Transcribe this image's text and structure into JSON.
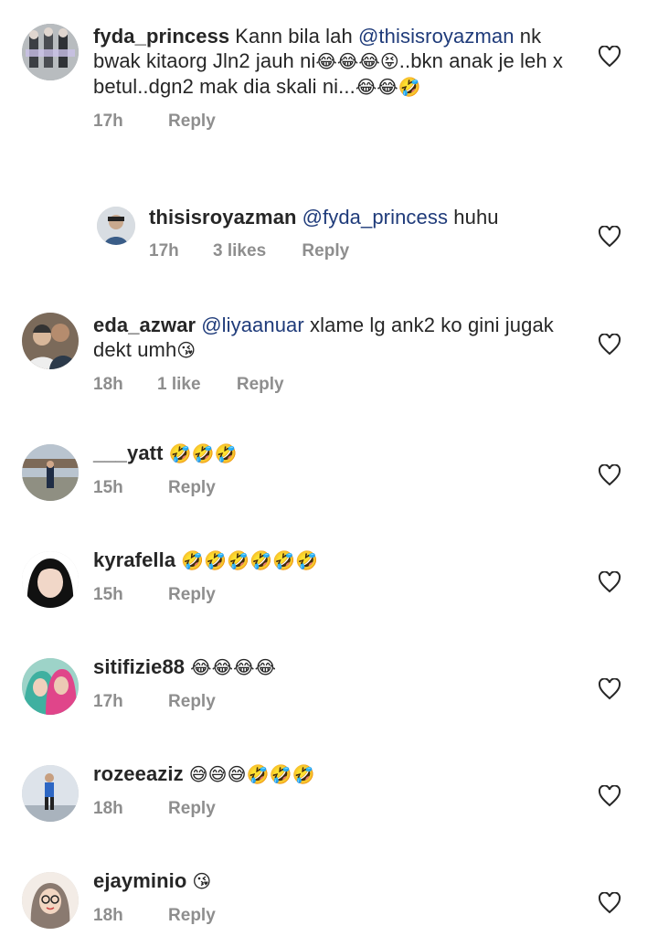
{
  "reply_label": "Reply",
  "comments": [
    {
      "username": "fyda_princess",
      "segments": [
        {
          "t": "Kann bila lah "
        },
        {
          "m": "@thisisroyazman"
        },
        {
          "t": " nk bwak kitaorg Jln2 jauh ni"
        },
        {
          "e": "😂😂😂😝"
        },
        {
          "t": "..bkn anak je leh x betul..dgn2 mak dia skali ni..."
        },
        {
          "e": "😂😂🤣"
        }
      ],
      "time": "17h",
      "likes": ""
    },
    {
      "username": "thisisroyazman",
      "segments": [
        {
          "m": "@fyda_princess"
        },
        {
          "t": " huhu"
        }
      ],
      "time": "17h",
      "likes": "3 likes"
    },
    {
      "username": "eda_azwar",
      "segments": [
        {
          "m": "@liyaanuar"
        },
        {
          "t": " xlame lg ank2 ko gini jugak dekt umh"
        },
        {
          "e": "😘"
        }
      ],
      "time": "18h",
      "likes": "1 like"
    },
    {
      "username": "___yatt",
      "segments": [
        {
          "e": "🤣🤣🤣"
        }
      ],
      "time": "15h",
      "likes": ""
    },
    {
      "username": "kyrafella",
      "segments": [
        {
          "e": "🤣🤣🤣🤣🤣🤣"
        }
      ],
      "time": "15h",
      "likes": ""
    },
    {
      "username": "sitifizie88",
      "segments": [
        {
          "e": "😂😂😂😂"
        }
      ],
      "time": "17h",
      "likes": ""
    },
    {
      "username": "rozeeaziz",
      "segments": [
        {
          "e": "😅😅😅🤣🤣🤣"
        }
      ],
      "time": "18h",
      "likes": ""
    },
    {
      "username": "ejayminio",
      "segments": [
        {
          "e": "😘"
        }
      ],
      "time": "18h",
      "likes": ""
    }
  ]
}
